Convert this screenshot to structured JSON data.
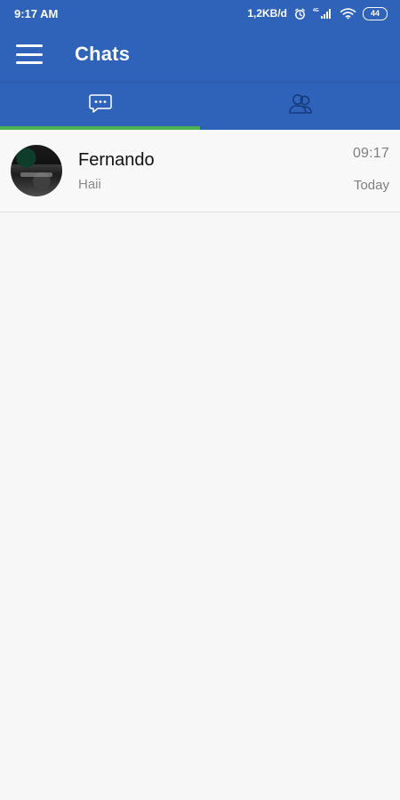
{
  "status_bar": {
    "time": "9:17 AM",
    "network_speed": "1,2KB/d",
    "alarm_icon": "alarm-icon",
    "signal_icon": "signal-icon",
    "signal_label": "4G",
    "wifi_icon": "wifi-icon",
    "battery_level": "44"
  },
  "app_bar": {
    "title": "Chats",
    "menu_icon": "menu-icon"
  },
  "tabs": [
    {
      "name": "chats",
      "icon": "chat-bubble-icon",
      "active": true
    },
    {
      "name": "contacts",
      "icon": "contacts-icon",
      "active": false
    }
  ],
  "chats": [
    {
      "name": "Fernando",
      "preview": "Haii",
      "time": "09:17",
      "day": "Today"
    }
  ],
  "colors": {
    "primary": "#2e63b9",
    "tab_indicator": "#4caf50",
    "background": "#f7f7f7",
    "secondary_text": "#8a8a8a"
  }
}
